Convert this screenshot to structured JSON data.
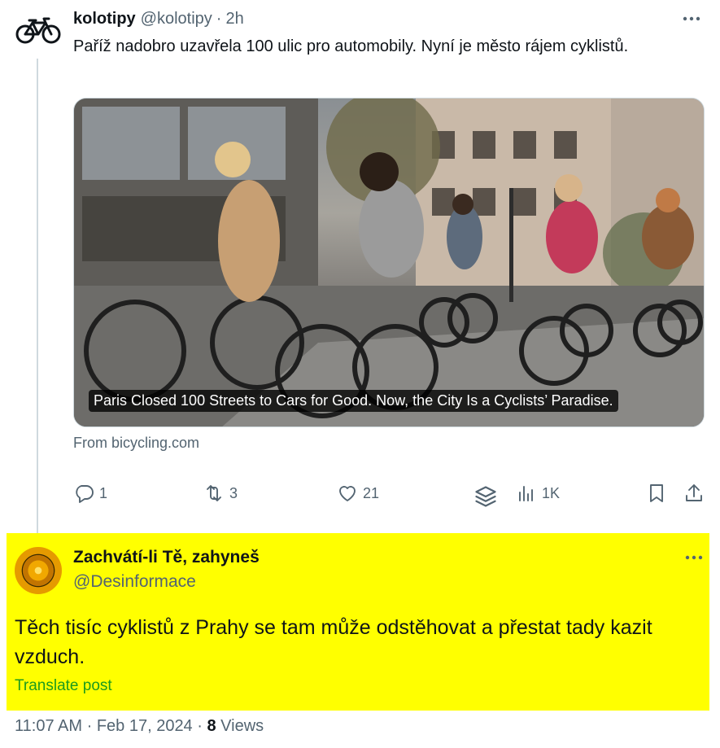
{
  "tweet": {
    "author_name": "kolotipy",
    "handle": "@kolotipy",
    "separator": "·",
    "time_ago": "2h",
    "text": "Paříž nadobro uzavřela 100 ulic pro automobily. Nyní je město rájem cyklistů.",
    "card": {
      "caption": "Paris Closed 100 Streets to Cars for Good. Now, the City Is a Cyclists’ Paradise.",
      "source": "From bicycling.com"
    },
    "actions": {
      "replies": "1",
      "retweets": "3",
      "likes": "21",
      "views": "1K"
    },
    "icons": {
      "avatar": "bicycle-icon",
      "more": "more-icon",
      "reply": "reply-icon",
      "retweet": "retweet-icon",
      "like": "heart-icon",
      "layers": "layers-icon",
      "views": "analytics-icon",
      "bookmark": "bookmark-icon",
      "share": "share-icon"
    }
  },
  "reply": {
    "author_name": "Zachvátí-li Tě, zahyneš",
    "handle": "@Desinformace",
    "text": "Těch tisíc cyklistů z Prahy se tam může odstěhovat a přestat tady kazit vzduch.",
    "translate_label": "Translate post",
    "highlight_color": "#ffff00"
  },
  "meta": {
    "time": "11:07 AM",
    "sep1": " · ",
    "date": "Feb 17, 2024",
    "sep2": " · ",
    "views_count": "8",
    "views_label": " Views"
  },
  "colors": {
    "text": "#0f1419",
    "secondary": "#536471",
    "translate": "#1d9b1d",
    "thread_line": "#cfd9de"
  }
}
